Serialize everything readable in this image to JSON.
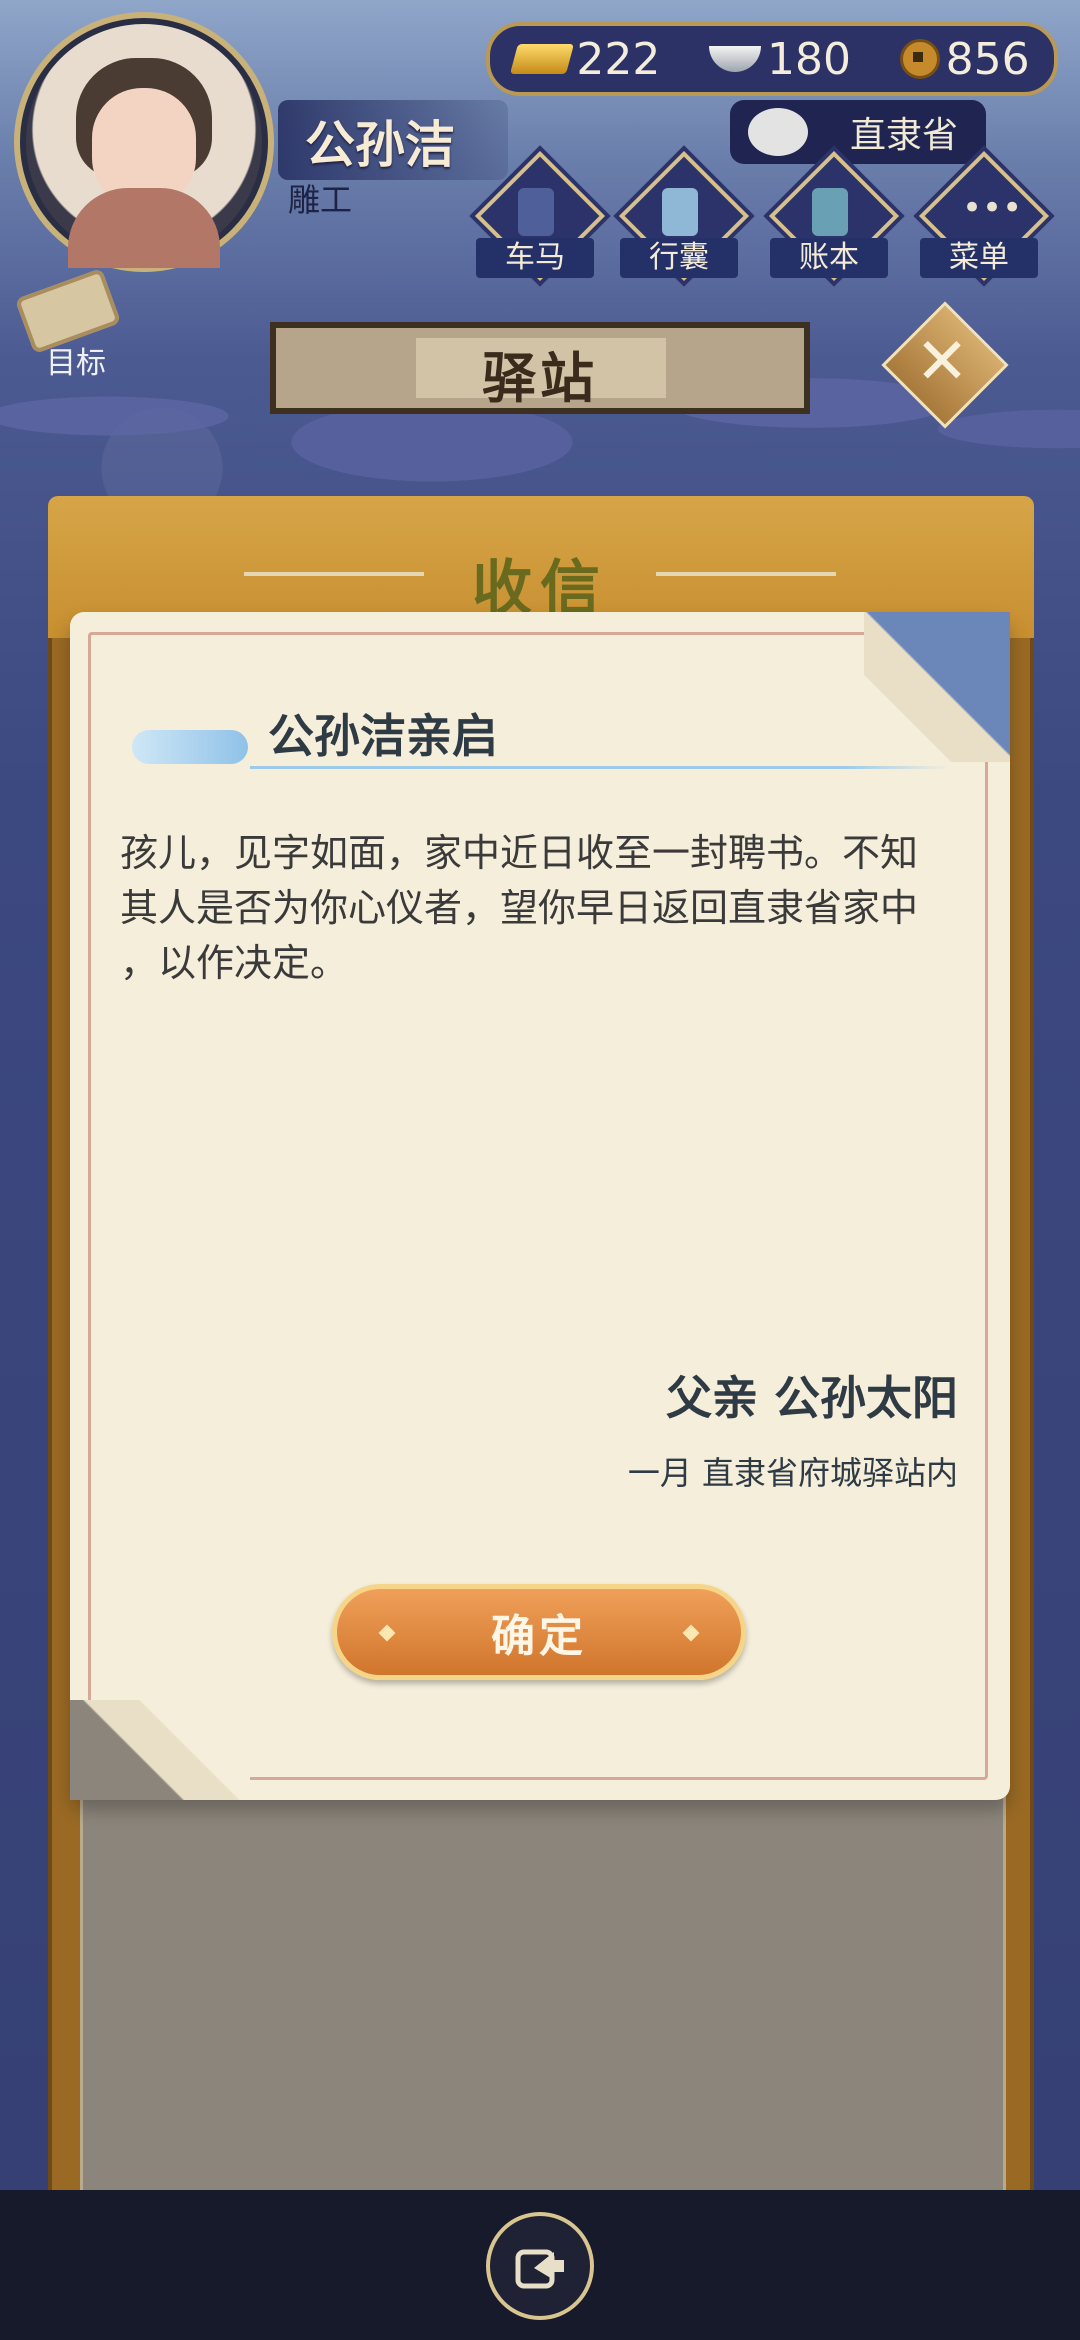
{
  "player": {
    "name": "公孙洁",
    "title": "雕工"
  },
  "currency": {
    "gold": "222",
    "silver": "180",
    "coins": "856"
  },
  "location": "直隶省",
  "nav": [
    {
      "label": "车马",
      "icon": "carriage-icon"
    },
    {
      "label": "行囊",
      "icon": "bag-icon"
    },
    {
      "label": "账本",
      "icon": "ledger-icon"
    },
    {
      "label": "菜单",
      "icon": "menu-icon"
    }
  ],
  "goal_label": "目标",
  "station_title": "驿站",
  "modal": {
    "title": "收信",
    "letter": {
      "recipient": "公孙洁亲启",
      "body": "孩儿，见字如面，家中近日收至一封聘书。不知\n其人是否为你心仪者，望你早日返回直隶省家中\n，以作决定。",
      "signature": "父亲 公孙太阳",
      "date_place": "一月 直隶省府城驿站内"
    },
    "confirm_label": "确定"
  },
  "colors": {
    "accent_gold": "#c88f30",
    "paper": "#f5eedb",
    "button_orange": "#d0752c"
  }
}
